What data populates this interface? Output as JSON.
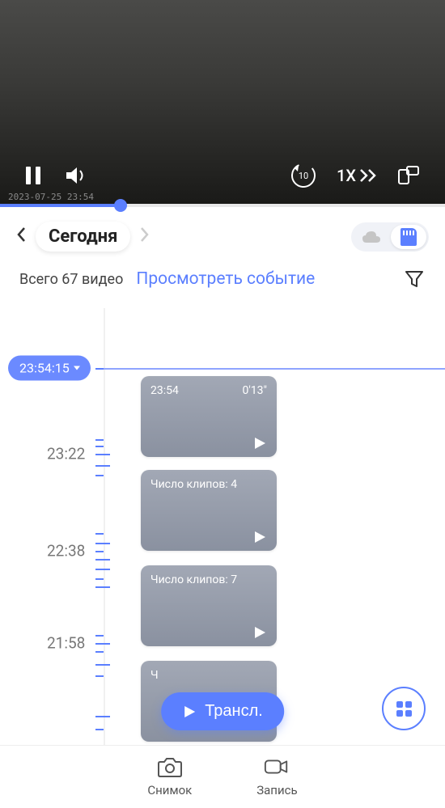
{
  "video": {
    "timestamp_overlay": "2023-07-25 23:54",
    "speed_label": "1X",
    "rewind_seconds": "10"
  },
  "date_nav": {
    "today_label": "Сегодня"
  },
  "info": {
    "total_text": "Всего 67 видео",
    "view_event": "Просмотреть событие"
  },
  "timeline": {
    "current_time": "23:54:15",
    "labels": [
      "23:22",
      "22:38",
      "21:58"
    ],
    "clips": [
      {
        "time": "23:54",
        "duration": "0'13\""
      },
      {
        "label": "Число клипов: 4"
      },
      {
        "label": "Число клипов: 7"
      },
      {
        "label": "Ч"
      }
    ]
  },
  "live_button": "Трансл.",
  "bottom": {
    "snapshot": "Снимок",
    "record": "Запись"
  }
}
